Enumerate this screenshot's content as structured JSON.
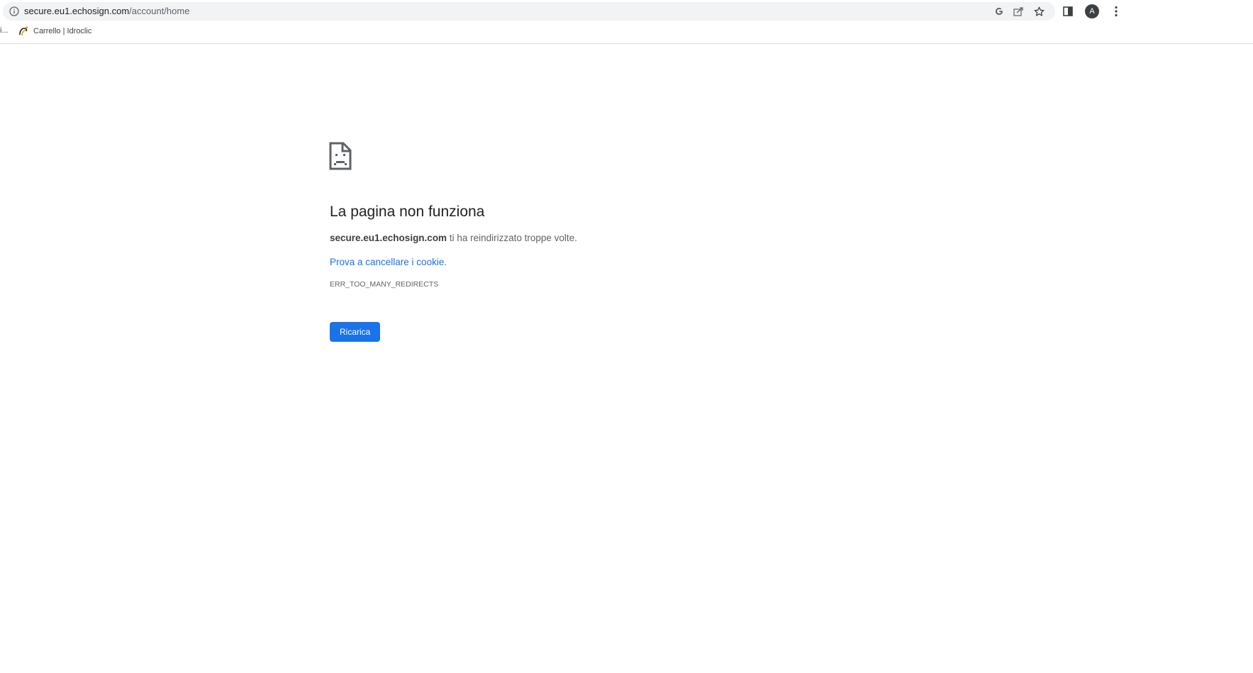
{
  "browser": {
    "url_host": "secure.eu1.echosign.com",
    "url_path": "/account/home",
    "avatar_letter": "A",
    "icons": [
      "info-icon",
      "google-lens-icon",
      "share-icon",
      "bookmark-star-icon",
      "side-panel-icon",
      "profile-avatar",
      "more-menu-icon"
    ]
  },
  "bookmarks": {
    "truncated_label": "i...",
    "items": [
      {
        "label": "Carrello | Idroclic",
        "icon": "idroclic-favicon"
      }
    ]
  },
  "error_page": {
    "icon": "sad-page-icon",
    "title": "La pagina non funziona",
    "host": "secure.eu1.echosign.com",
    "message": " ti ha reindirizzato troppe volte.",
    "suggestion_link": "Prova a cancellare i cookie",
    "suggestion_suffix": ".",
    "error_code": "ERR_TOO_MANY_REDIRECTS",
    "reload_label": "Ricarica"
  },
  "colors": {
    "accent": "#1a73e8",
    "text": "#202124",
    "secondary_text": "#5f6368",
    "omnibox_bg": "#f1f3f4"
  }
}
